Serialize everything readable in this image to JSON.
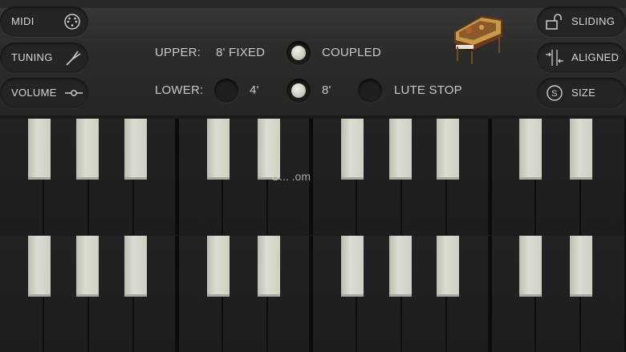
{
  "left_menu": {
    "midi": "MIDI",
    "tuning": "TUNING",
    "volume": "VOLUME"
  },
  "right_menu": {
    "sliding": "SLIDING",
    "aligned": "ALIGNED",
    "size": "SIZE"
  },
  "registers": {
    "upper_label": "UPPER:",
    "upper_value": "8' FIXED",
    "coupled": "COUPLED",
    "lower_label": "LOWER:",
    "four_foot": "4'",
    "eight_foot": "8'",
    "lute_stop": "LUTE STOP",
    "coupled_on": true,
    "four_foot_on": false,
    "eight_foot_on": true,
    "lute_stop_on": false
  },
  "watermark": "U... .om",
  "icons": {
    "midi": "midi-connector-icon",
    "tuning": "tuning-fork-icon",
    "volume": "slider-icon",
    "sliding": "unlock-icon",
    "aligned": "align-icon",
    "size": "size-s-icon",
    "instrument": "harpsichord-image"
  },
  "colors": {
    "key_natural": "#d6d6ca",
    "key_accidental": "#1d1d1d",
    "panel": "#2c2c2b",
    "text": "#d6d6d0"
  }
}
